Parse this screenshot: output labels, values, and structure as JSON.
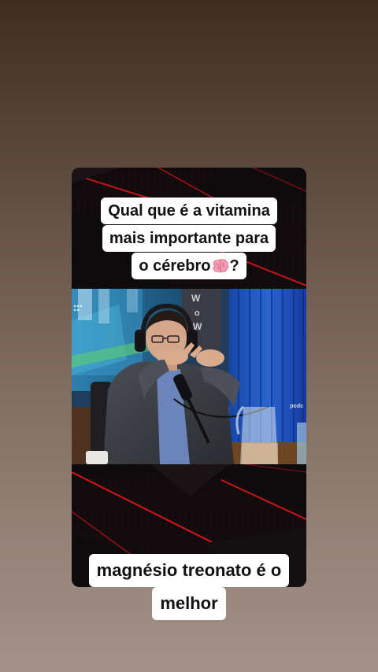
{
  "captions": {
    "top_lines": [
      "Qual que é a vitamina",
      "mais importante para",
      "o cérebro"
    ],
    "top_suffix": "?",
    "top_emoji_icon": "brain-icon",
    "bottom_lines": [
      "magnésio treonato é o",
      "melhor"
    ]
  },
  "video": {
    "overlay_small_text": "podc"
  },
  "colors": {
    "caption_background": "#ffffff",
    "caption_text": "#111111",
    "accent_red": "#c8141c",
    "card_background": "#0b0b0c"
  }
}
